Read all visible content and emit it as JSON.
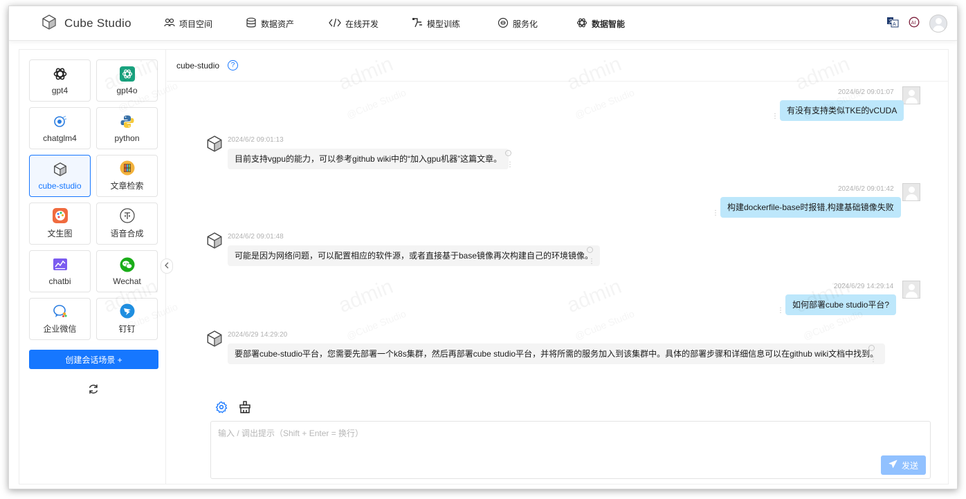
{
  "app": {
    "name": "Cube Studio"
  },
  "nav": [
    {
      "label": "项目空间",
      "icon": "team-icon"
    },
    {
      "label": "数据资产",
      "icon": "database-icon"
    },
    {
      "label": "在线开发",
      "icon": "code-icon"
    },
    {
      "label": "模型训练",
      "icon": "flow-icon"
    },
    {
      "label": "服务化",
      "icon": "service-icon"
    },
    {
      "label": "数据智能",
      "icon": "openai-icon",
      "active": true
    }
  ],
  "topRight": {
    "translate": "translate-icon",
    "ai": "AI"
  },
  "agents": [
    {
      "label": "gpt4",
      "icon": "openai-icon"
    },
    {
      "label": "gpt4o",
      "icon": "openai-green-icon"
    },
    {
      "label": "chatglm4",
      "icon": "chatglm-icon"
    },
    {
      "label": "python",
      "icon": "python-icon"
    },
    {
      "label": "cube-studio",
      "icon": "cube-icon",
      "active": true
    },
    {
      "label": "文章检索",
      "icon": "bookshelf-icon"
    },
    {
      "label": "文生图",
      "icon": "palette-icon"
    },
    {
      "label": "语音合成",
      "icon": "voice-icon"
    },
    {
      "label": "chatbi",
      "icon": "chart-icon"
    },
    {
      "label": "Wechat",
      "icon": "wechat-icon"
    },
    {
      "label": "企业微信",
      "icon": "wecom-icon"
    },
    {
      "label": "钉钉",
      "icon": "dingtalk-icon"
    }
  ],
  "sidebar": {
    "create_label": "创建会话场景 +"
  },
  "chat": {
    "title": "cube-studio",
    "help": "?",
    "messages": [
      {
        "role": "user",
        "time": "2024/6/2 09:01:07",
        "text": "有没有支持类似TKE的vCUDA"
      },
      {
        "role": "bot",
        "time": "2024/6/2 09:01:13",
        "text": "目前支持vgpu的能力，可以参考github wiki中的“加入gpu机器”这篇文章。"
      },
      {
        "role": "user",
        "time": "2024/6/2 09:01:42",
        "text": "构建dockerfile-base时报错,构建基础镜像失败"
      },
      {
        "role": "bot",
        "time": "2024/6/2 09:01:48",
        "text": "可能是因为网络问题，可以配置相应的软件源，或者直接基于base镜像再次构建自己的环境镜像。"
      },
      {
        "role": "user",
        "time": "2024/6/29 14:29:14",
        "text": "如何部署cube studio平台?"
      },
      {
        "role": "bot",
        "time": "2024/6/29 14:29:20",
        "text": "要部署cube-studio平台，您需要先部署一个k8s集群，然后再部署cube studio平台，并将所需的服务加入到该集群中。具体的部署步骤和详细信息可以在github wiki文档中找到。"
      }
    ]
  },
  "input": {
    "placeholder": "输入 / 调出提示（Shift + Enter = 换行）",
    "send_label": "发送"
  },
  "watermark": {
    "user": "admin",
    "brand": "@Cube Studio"
  },
  "colors": {
    "primary": "#1677ff",
    "userBubble": "#bde7fb",
    "botBubble": "#f4f4f4",
    "sendDisabled": "#91c1ff"
  }
}
